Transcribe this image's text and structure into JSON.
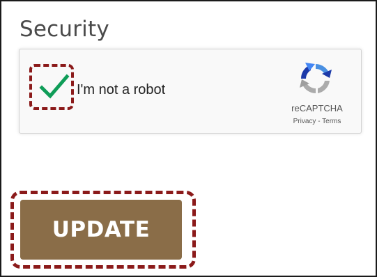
{
  "security": {
    "title": "Security"
  },
  "recaptcha": {
    "label": "I'm not a robot",
    "checked": true,
    "brand": "reCAPTCHA",
    "privacy": "Privacy",
    "separator": " - ",
    "terms": "Terms",
    "icon": "recaptcha-logo-icon"
  },
  "form": {
    "update_label": "UPDATE"
  },
  "colors": {
    "check_green": "#0f9d58",
    "highlight": "#8b1a1a",
    "button_bg": "#8a6d48"
  }
}
